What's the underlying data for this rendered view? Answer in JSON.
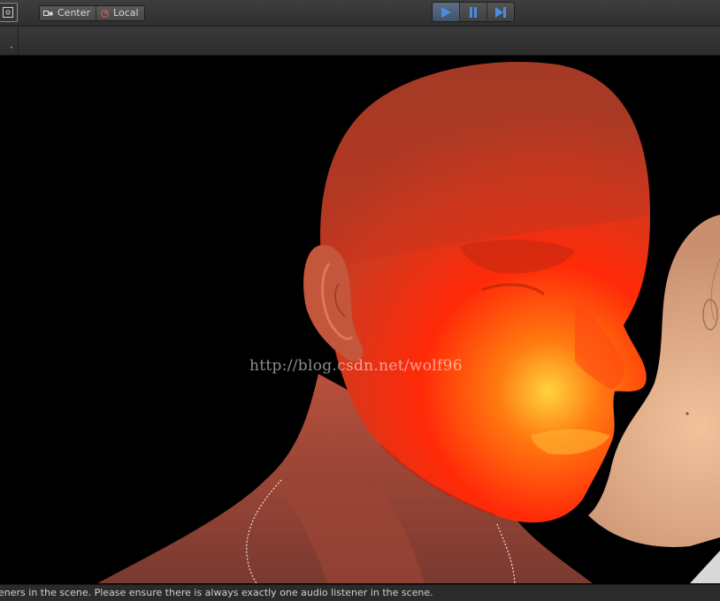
{
  "toolbar": {
    "pivot_position": "Center",
    "pivot_rotation": "Local",
    "playback": {
      "play_icon": "play-icon",
      "pause_icon": "pause-icon",
      "step_icon": "step-icon"
    }
  },
  "scene": {
    "watermark": "http://blog.csdn.net/wolf96"
  },
  "status": {
    "message": "eners in the scene. Please ensure there is always exactly one audio listener in the scene."
  },
  "colors": {
    "toolbar_bg": "#353535",
    "play_active": "#4a8de0",
    "background": "#000000",
    "head_main": "#ff3a10",
    "head_highlight": "#ffd040",
    "second_head_skin": "#e8b48e"
  }
}
